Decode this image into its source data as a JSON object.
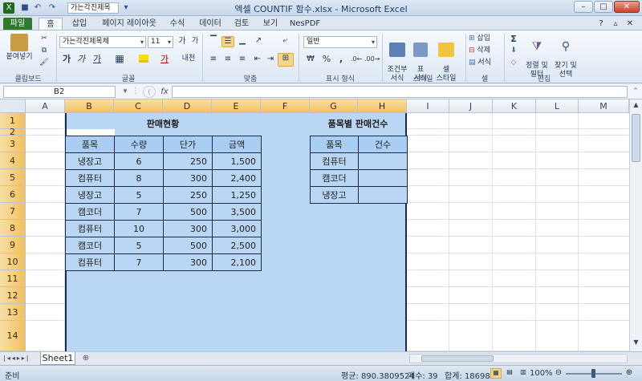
{
  "window": {
    "title": "엑셀 COUNTIF 함수.xlsx - Microsoft Excel",
    "quick_access_font": "가는각진제목",
    "controls": {
      "minimize": "–",
      "maximize": "□",
      "close": "✕"
    }
  },
  "ribbon": {
    "tabs": [
      "파일",
      "홈",
      "삽입",
      "페이지 레이아웃",
      "수식",
      "데이터",
      "검토",
      "보기",
      "NesPDF"
    ],
    "clipboard": {
      "paste": "붙여넣기",
      "label": "클립보드"
    },
    "font": {
      "name": "가는각진제목체",
      "size": "11",
      "bold": "가",
      "italic": "가",
      "underline": "가",
      "grow": "가",
      "shrink": "가",
      "label": "글꼴"
    },
    "alignment": {
      "label": "맞춤"
    },
    "number": {
      "format": "일반",
      "percent": "%",
      "comma": ",",
      "label": "표시 형식"
    },
    "styles": {
      "conditional": "조건부\n서식",
      "table": "표\n서식",
      "cell": "셀\n스타일",
      "label": "스타일"
    },
    "cells": {
      "insert": "삽입",
      "delete": "삭제",
      "format": "서식",
      "label": "셀"
    },
    "editing": {
      "sum": "Σ",
      "sort": "정렬 및\n필터",
      "find": "찾기 및\n선택",
      "label": "편집"
    }
  },
  "formula_bar": {
    "name_box": "B2",
    "fx": "fx",
    "value": ""
  },
  "sheet": {
    "columns": [
      "A",
      "B",
      "C",
      "D",
      "E",
      "F",
      "G",
      "H",
      "I",
      "J",
      "K",
      "L",
      "M"
    ],
    "selected_columns": [
      "B",
      "C",
      "D",
      "E",
      "F",
      "G",
      "H"
    ],
    "rows": [
      "1",
      "2",
      "3",
      "4",
      "5",
      "6",
      "7",
      "8",
      "9",
      "10",
      "11",
      "12",
      "13",
      "14"
    ],
    "sales_title": "판매현황",
    "sales_headers": [
      "품목",
      "수량",
      "단가",
      "금액"
    ],
    "sales_rows": [
      [
        "냉장고",
        "6",
        "250",
        "1,500"
      ],
      [
        "컴퓨터",
        "8",
        "300",
        "2,400"
      ],
      [
        "냉장고",
        "5",
        "250",
        "1,250"
      ],
      [
        "캠코더",
        "7",
        "500",
        "3,500"
      ],
      [
        "컴퓨터",
        "10",
        "300",
        "3,000"
      ],
      [
        "캠코더",
        "5",
        "500",
        "2,500"
      ],
      [
        "컴퓨터",
        "7",
        "300",
        "2,100"
      ]
    ],
    "count_title": "품목별 판매건수",
    "count_headers": [
      "품목",
      "건수"
    ],
    "count_rows": [
      [
        "컴퓨터",
        ""
      ],
      [
        "캠코더",
        ""
      ],
      [
        "냉장고",
        ""
      ]
    ]
  },
  "sheet_tabs": {
    "active": "Sheet1"
  },
  "status": {
    "mode": "준비",
    "average": "평균: 890.3809524",
    "count": "개수: 39",
    "sum": "합계: 18698",
    "zoom": "100%"
  }
}
